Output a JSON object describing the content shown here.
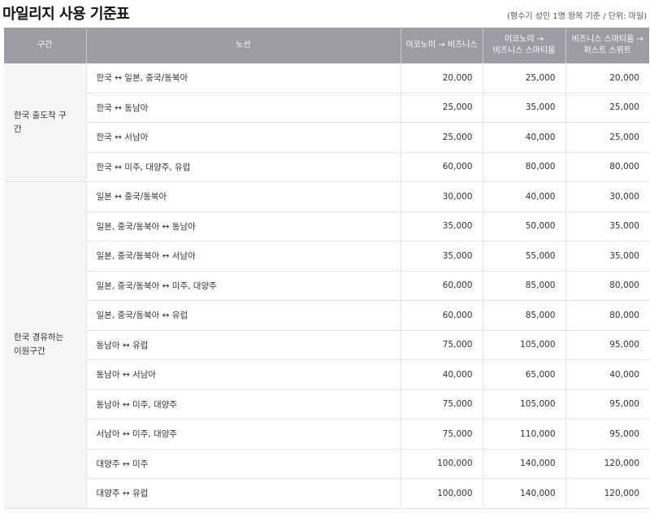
{
  "title": "마일리지 사용 기준표",
  "note": "(평수기 성인 1명 왕복 기준 / 단위: 마일)",
  "table": {
    "headers": [
      "구간",
      "노선",
      "이코노미 → 비즈니스",
      "이코노미 →\n비즈니스 스마티움",
      "비즈니스 스마티움 →\n퍼스트 스위트"
    ],
    "groups": [
      {
        "label": "한국 출도착 구간",
        "rows": [
          {
            "route": "한국 ↔ 일본, 중국/동북아",
            "v": [
              "20,000",
              "25,000",
              "20,000"
            ]
          },
          {
            "route": "한국 ↔ 동남아",
            "v": [
              "25,000",
              "35,000",
              "25,000"
            ]
          },
          {
            "route": "한국 ↔ 서남아",
            "v": [
              "25,000",
              "40,000",
              "25,000"
            ]
          },
          {
            "route": "한국 ↔ 미주, 대양주, 유럽",
            "v": [
              "60,000",
              "80,000",
              "80,000"
            ]
          }
        ]
      },
      {
        "label": "한국 경유하는 이원구간",
        "rows": [
          {
            "route": "일본 ↔ 중국/동북아",
            "v": [
              "30,000",
              "40,000",
              "30,000"
            ]
          },
          {
            "route": "일본, 중국/동북아 ↔ 동남아",
            "v": [
              "35,000",
              "50,000",
              "35,000"
            ]
          },
          {
            "route": "일본, 중국/동북아 ↔ 서남아",
            "v": [
              "35,000",
              "55,000",
              "35,000"
            ]
          },
          {
            "route": "일본, 중국/동북아 ↔ 미주, 대양주",
            "v": [
              "60,000",
              "85,000",
              "80,000"
            ]
          },
          {
            "route": "일본, 중국/동북아 ↔ 유럽",
            "v": [
              "60,000",
              "85,000",
              "80,000"
            ]
          },
          {
            "route": "동남아 ↔ 유럽",
            "v": [
              "75,000",
              "105,000",
              "95,000"
            ]
          },
          {
            "route": "동남아 ↔ 서남아",
            "v": [
              "40,000",
              "65,000",
              "40,000"
            ]
          },
          {
            "route": "동남아 ↔ 미주, 대양주",
            "v": [
              "75,000",
              "105,000",
              "95,000"
            ]
          },
          {
            "route": "서남아 ↔ 미주, 대양주",
            "v": [
              "75,000",
              "110,000",
              "95,000"
            ]
          },
          {
            "route": "대양주 ↔ 미주",
            "v": [
              "100,000",
              "140,000",
              "120,000"
            ]
          },
          {
            "route": "대양주 ↔ 유럽",
            "v": [
              "100,000",
              "140,000",
              "120,000"
            ]
          }
        ]
      }
    ]
  },
  "colors": {
    "header_bg": "#9c9da4",
    "group_bg": "#f5f5f5",
    "border": "#e4e4e4"
  }
}
